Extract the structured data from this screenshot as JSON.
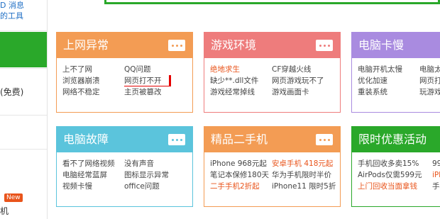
{
  "sidebar": {
    "top_line1": "D 消息",
    "top_line2": "的工具",
    "free_label": "(免费)",
    "new_badge": "New",
    "bottom_label": "机"
  },
  "colors": {
    "green": "#2aa82a",
    "orange": "#f39c54",
    "pink": "#ee7c7c",
    "purple": "#a98be0",
    "cyan": "#5bc4dc",
    "highlight_red": "#e40000"
  },
  "cards": [
    {
      "title": "上网异常",
      "more_icon": "more-dots-icon",
      "links": [
        "上不了网",
        "QQ问题",
        "浏览器崩溃",
        "网页打不开",
        "网络不稳定",
        "主页被篡改"
      ]
    },
    {
      "title": "游戏环境",
      "more_icon": "more-dots-icon",
      "links": [
        "绝地求生",
        "CF穿越火线",
        "缺少**.dll文件",
        "网页游戏玩不了",
        "游戏经常掉线",
        "游戏画面卡"
      ]
    },
    {
      "title": "电脑卡慢",
      "more_icon": "more-dots-icon",
      "links": [
        "电脑开机太慢",
        "电脑太",
        "优化加速",
        "网页打",
        "重装系统",
        "玩游戏"
      ]
    },
    {
      "title": "电脑故障",
      "more_icon": "more-dots-icon",
      "links": [
        "看不了网络视频",
        "没有声音",
        "电脑经常蓝屏",
        "图标显示异常",
        "视频卡慢",
        "office问题"
      ]
    },
    {
      "title": "精品二手机",
      "more_icon": "more-dots-icon",
      "links": [
        "iPhone 968元起",
        "安卓手机 418元起",
        "笔记本保修180天",
        "华为手机限时半价",
        "二手手机2折起",
        "iPhone11 限时5折"
      ]
    },
    {
      "title": "限时优惠活动",
      "more_icon": "more-dots-icon",
      "links": [
        "手机回收多卖15%",
        "99新手",
        "AirPods仅需599元",
        "iPhon",
        "上门回收当面拿钱",
        "手机"
      ]
    }
  ]
}
